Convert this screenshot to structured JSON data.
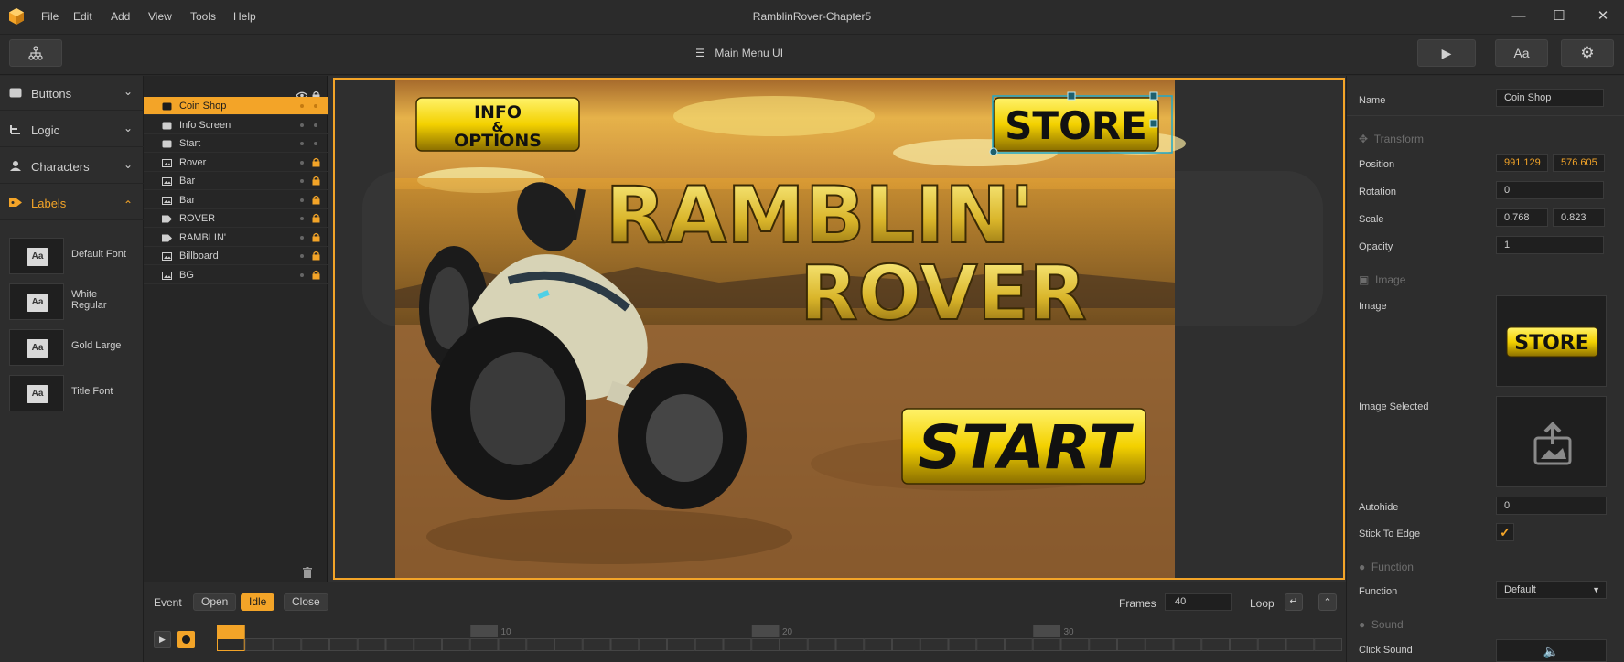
{
  "app": {
    "window_title": "RamblinRover-Chapter5",
    "menu": [
      "File",
      "Edit",
      "Add",
      "View",
      "Tools",
      "Help"
    ],
    "window_controls": [
      "minimize-icon",
      "maximize-icon",
      "close-icon"
    ]
  },
  "toolbar": {
    "scene_title": "Main Menu UI",
    "play_icon": "play-icon",
    "font_button_label": "Aa",
    "settings_icon": "gear-icon",
    "hierarchy_icon": "hierarchy-icon"
  },
  "left_panel": {
    "categories": [
      {
        "label": "Buttons",
        "icon": "button-icon",
        "expanded": false
      },
      {
        "label": "Logic",
        "icon": "logic-icon",
        "expanded": false
      },
      {
        "label": "Characters",
        "icon": "person-icon",
        "expanded": false
      },
      {
        "label": "Labels",
        "icon": "tag-icon",
        "expanded": true
      }
    ],
    "labels": [
      {
        "thumb": "Aa",
        "name": "Default Font"
      },
      {
        "thumb": "Aa",
        "name": "White Regular"
      },
      {
        "thumb": "Aa",
        "name": "Gold Large"
      },
      {
        "thumb": "Aa",
        "name": "Title Font"
      }
    ]
  },
  "hierarchy": {
    "rows": [
      {
        "name": "Coin Shop",
        "icon": "button-icon",
        "locked": false,
        "selected": true
      },
      {
        "name": "Info Screen",
        "icon": "button-icon",
        "locked": false
      },
      {
        "name": "Start",
        "icon": "button-icon",
        "locked": false
      },
      {
        "name": "Rover",
        "icon": "image-icon",
        "locked": true
      },
      {
        "name": "Bar",
        "icon": "image-icon",
        "locked": true
      },
      {
        "name": "Bar",
        "icon": "image-icon",
        "locked": true
      },
      {
        "name": "ROVER",
        "icon": "label-icon",
        "locked": true
      },
      {
        "name": "RAMBLIN'",
        "icon": "label-icon",
        "locked": true
      },
      {
        "name": "Billboard",
        "icon": "image-icon",
        "locked": true
      },
      {
        "name": "BG",
        "icon": "image-icon",
        "locked": true
      }
    ]
  },
  "canvas": {
    "info_button": [
      "INFO",
      "&",
      "OPTIONS"
    ],
    "store_button": "STORE",
    "title_line1": "RAMBLIN'",
    "title_line2": "ROVER",
    "start_button": "START"
  },
  "timeline": {
    "event_label": "Event",
    "events": [
      "Open",
      "Idle",
      "Close"
    ],
    "active_event": "Idle",
    "frames_label": "Frames",
    "frames_value": "40",
    "loop_label": "Loop",
    "ticks": [
      "0",
      "10",
      "20",
      "30"
    ]
  },
  "inspector": {
    "name_label": "Name",
    "name_value": "Coin Shop",
    "transform_header": "Transform",
    "position_label": "Position",
    "position_x": "991.129",
    "position_y": "576.605",
    "rotation_label": "Rotation",
    "rotation_value": "0",
    "scale_label": "Scale",
    "scale_x": "0.768",
    "scale_y": "0.823",
    "opacity_label": "Opacity",
    "opacity_value": "1",
    "image_header": "Image",
    "image_label": "Image",
    "image_preview_text": "STORE",
    "image_selected_label": "Image Selected",
    "autohide_label": "Autohide",
    "autohide_value": "0",
    "stick_label": "Stick To Edge",
    "stick_checked": true,
    "function_header": "Function",
    "function_label": "Function",
    "function_value": "Default",
    "sound_header": "Sound",
    "click_sound_label": "Click Sound"
  },
  "colors": {
    "accent": "#f3a428",
    "panel": "#2d2d2d",
    "field": "#1f1f1f",
    "selection_cyan": "#1fa8c9"
  }
}
